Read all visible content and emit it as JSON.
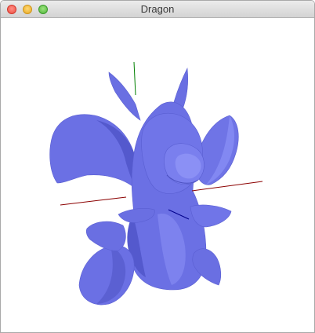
{
  "window": {
    "title": "Dragon",
    "controls": [
      "close",
      "minimize",
      "zoom"
    ]
  },
  "scene": {
    "background": "#ffffff",
    "model_color": "#6d72e6",
    "model_shadow": "#4f53c4",
    "model_highlight": "#8e93f5",
    "axes": {
      "x_color": "#8b0000",
      "y_color": "#008000",
      "z_color": "#00008b"
    }
  }
}
